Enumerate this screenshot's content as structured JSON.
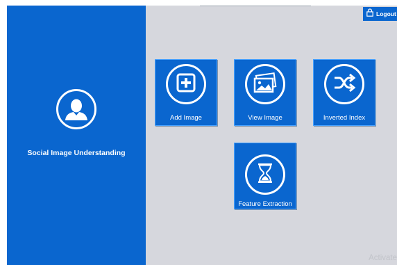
{
  "header": {
    "logout_label": "Logout"
  },
  "sidebar": {
    "title": "Social Image Understanding"
  },
  "tiles": {
    "add_image": "Add Image",
    "view_image": "View Image",
    "inverted_index": "Inverted Index",
    "feature_extraction": "Feature Extraction"
  },
  "watermark": "Activate",
  "colors": {
    "accent": "#0a66cf",
    "background": "#d6d7dd",
    "tile_border": "#4aa3ff"
  },
  "icons": [
    "user-icon",
    "lock-icon",
    "plus-icon",
    "images-icon",
    "shuffle-icon",
    "hourglass-icon"
  ]
}
